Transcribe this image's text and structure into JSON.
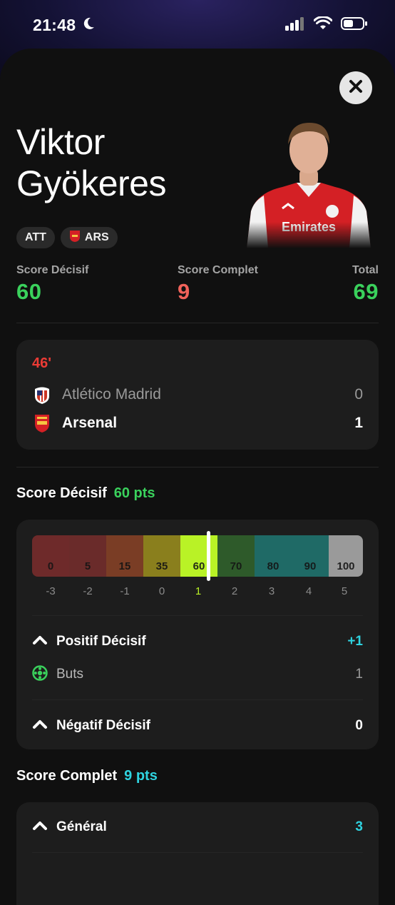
{
  "status_bar": {
    "time": "21:48"
  },
  "player": {
    "name_line1": "Viktor",
    "name_line2": "Gyökeres",
    "position": "ATT",
    "team_abbr": "ARS"
  },
  "scores": [
    {
      "label": "Score Décisif",
      "value": "60",
      "color": "#3ad15c"
    },
    {
      "label": "Score Complet",
      "value": "9",
      "color": "#f0625a"
    },
    {
      "label": "Total",
      "value": "69",
      "color": "#3ad15c"
    }
  ],
  "match": {
    "minute": "46'",
    "home": {
      "name": "Atlético Madrid",
      "score": "0"
    },
    "away": {
      "name": "Arsenal",
      "score": "1"
    }
  },
  "score_decisif": {
    "title": "Score Décisif",
    "pts": "60 pts",
    "scale": [
      {
        "label": "0",
        "tick": "-3",
        "color": "#6e2a2a"
      },
      {
        "label": "5",
        "tick": "-2",
        "color": "#6a2b2a"
      },
      {
        "label": "15",
        "tick": "-1",
        "color": "#7a3d25"
      },
      {
        "label": "35",
        "tick": "0",
        "color": "#8a7f1d"
      },
      {
        "label": "60",
        "tick": "1",
        "color": "#b9f226"
      },
      {
        "label": "70",
        "tick": "2",
        "color": "#2e5a2a"
      },
      {
        "label": "80",
        "tick": "3",
        "color": "#1f6a66"
      },
      {
        "label": "90",
        "tick": "4",
        "color": "#1f6a66"
      },
      {
        "label": "100",
        "tick": "5",
        "color": "#9a9a9a"
      }
    ],
    "active_index": 4,
    "positif": {
      "label": "Positif Décisif",
      "value": "+1"
    },
    "buts": {
      "label": "Buts",
      "value": "1"
    },
    "negatif": {
      "label": "Négatif Décisif",
      "value": "0"
    }
  },
  "score_complet": {
    "title": "Score Complet",
    "pts": "9 pts",
    "general": {
      "label": "Général",
      "value": "3"
    }
  }
}
